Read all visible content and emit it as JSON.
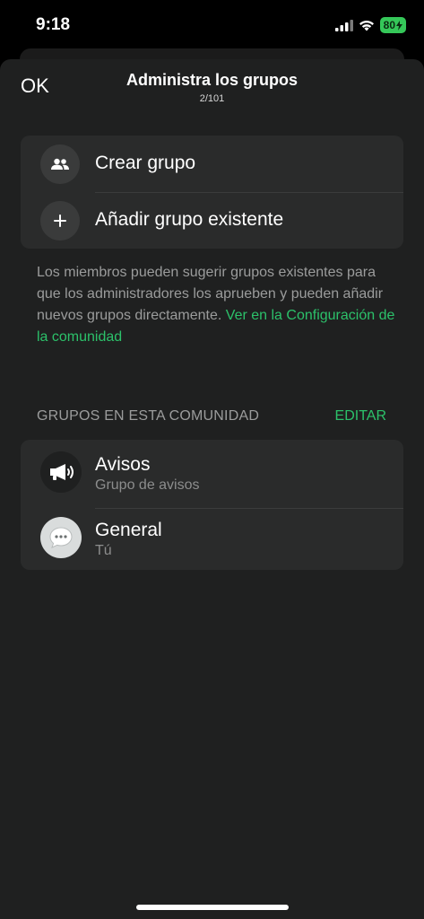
{
  "status_bar": {
    "time": "9:18",
    "battery": "80"
  },
  "header": {
    "ok_label": "OK",
    "title": "Administra los grupos",
    "subtitle": "2/101"
  },
  "actions": [
    {
      "label": "Crear grupo",
      "icon": "people-icon"
    },
    {
      "label": "Añadir grupo existente",
      "icon": "plus-icon"
    }
  ],
  "info": {
    "text": "Los miembros pueden sugerir grupos existentes para que los administradores los aprueben y pueden añadir nuevos grupos directamente.",
    "link": "Ver en la Configuración de la comunidad"
  },
  "groups_section": {
    "heading": "GRUPOS EN ESTA COMUNIDAD",
    "edit_label": "EDITAR",
    "groups": [
      {
        "name": "Avisos",
        "subtitle": "Grupo de avisos",
        "icon": "megaphone-icon"
      },
      {
        "name": "General",
        "subtitle": "Tú",
        "icon": "chat-bubble-icon"
      }
    ]
  },
  "colors": {
    "accent": "#2cc16a",
    "sheet_bg": "#1f2020",
    "card_bg": "#2a2b2b",
    "battery": "#35c759"
  }
}
